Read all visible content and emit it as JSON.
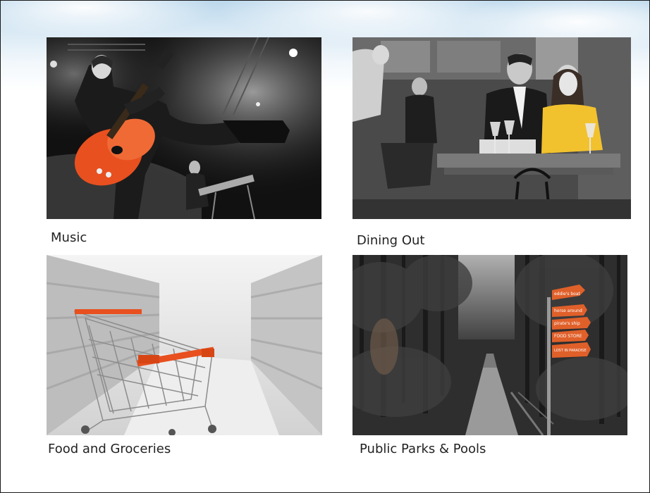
{
  "categories": [
    {
      "label": "Music"
    },
    {
      "label": "Dining Out"
    },
    {
      "label": "Food and Groceries"
    },
    {
      "label": "Public Parks & Pools"
    }
  ],
  "signpost": {
    "signs": [
      "eddie's boat",
      "horse around",
      "pirate's ship",
      "FOOD STORE",
      "LOST IN PARADISE"
    ]
  },
  "colors": {
    "accent_orange": "#e8501f",
    "highlight_yellow": "#f2c12e",
    "sign_orange": "#e0602a"
  }
}
